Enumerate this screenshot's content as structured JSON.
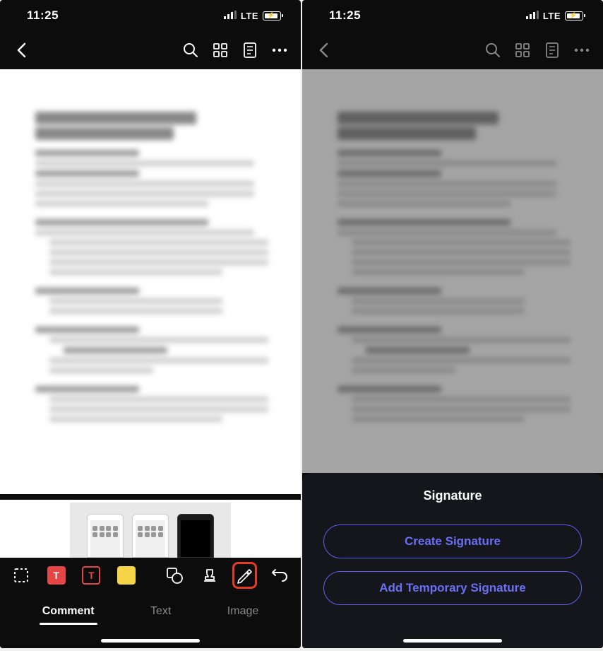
{
  "status": {
    "time": "11:25",
    "network": "LTE"
  },
  "toolbar": {
    "tabs": {
      "comment": "Comment",
      "text": "Text",
      "image": "Image"
    }
  },
  "signature_panel": {
    "title": "Signature",
    "create_btn": "Create Signature",
    "temp_btn": "Add Temporary Signature"
  }
}
